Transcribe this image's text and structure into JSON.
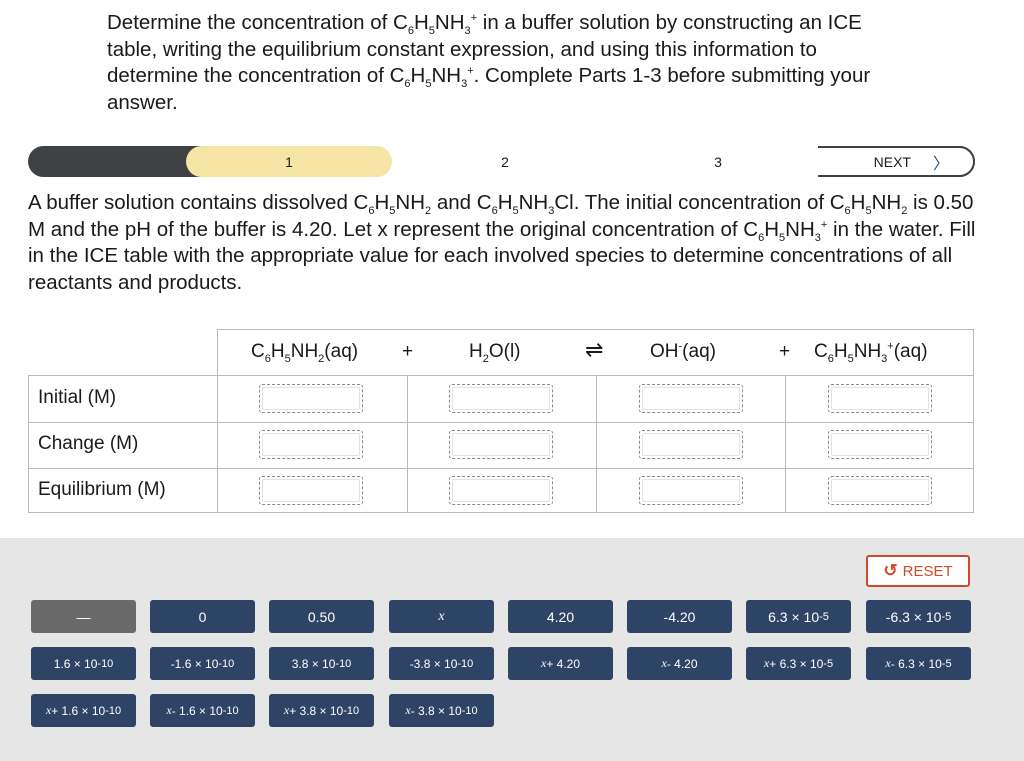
{
  "intro_html": "Determine the concentration of C<sub>6</sub>H<sub>5</sub>NH<sub>3</sub><sup>+</sup> in a buffer solution by constructing an ICE table, writing the equilibrium constant expression, and using this information to determine the concentration of C<sub>6</sub>H<sub>5</sub>NH<sub>3</sub><sup>+</sup>. Complete Parts 1-3 before submitting your answer.",
  "progress": {
    "steps": [
      "1",
      "2",
      "3"
    ],
    "active_step": "1",
    "next_label": "NEXT",
    "next_icon": "chevron-right-icon"
  },
  "question_html": "A buffer solution contains dissolved C<sub>6</sub>H<sub>5</sub>NH<sub>2</sub> and C<sub>6</sub>H<sub>5</sub>NH<sub>3</sub>Cl. The initial concentration of C<sub>6</sub>H<sub>5</sub>NH<sub>2</sub> is 0.50 M and the pH of the buffer is 4.20. Let x represent the original concentration of C<sub>6</sub>H<sub>5</sub>NH<sub>3</sub><sup>+</sup> in the water. Fill in the ICE table with the appropriate value for each involved species to determine concentrations of all reactants and products.",
  "ice_table": {
    "species_html": [
      "C<sub>6</sub>H<sub>5</sub>NH<sub>2</sub>(aq)",
      "+",
      "H<sub>2</sub>O(l)",
      "⇌",
      "OH<sup>-</sup>(aq)",
      "+",
      "C<sub>6</sub>H<sub>5</sub>NH<sub>3</sub><sup>+</sup>(aq)"
    ],
    "rows": [
      "Initial (M)",
      "Change (M)",
      "Equilibrium (M)"
    ]
  },
  "answer_tray": {
    "reset_label": "RESET",
    "reset_icon": "undo-icon",
    "tiles": [
      {
        "html": "—",
        "enabled": false
      },
      {
        "html": "0",
        "enabled": true
      },
      {
        "html": "0.50",
        "enabled": true
      },
      {
        "html": "<span class=\"ital\">x</span>",
        "enabled": true
      },
      {
        "html": "4.20",
        "enabled": true
      },
      {
        "html": "-4.20",
        "enabled": true
      },
      {
        "html": "6.3 × 10<sup>-5</sup>",
        "enabled": true
      },
      {
        "html": "-6.3 × 10<sup>-5</sup>",
        "enabled": true
      },
      {
        "html": "1.6 × 10<sup>-10</sup>",
        "enabled": true
      },
      {
        "html": "-1.6 × 10<sup>-10</sup>",
        "enabled": true
      },
      {
        "html": "3.8 × 10<sup>-10</sup>",
        "enabled": true
      },
      {
        "html": "-3.8 × 10<sup>-10</sup>",
        "enabled": true
      },
      {
        "html": "<span class=\"ital\">x</span> + 4.20",
        "enabled": true
      },
      {
        "html": "<span class=\"ital\">x</span> - 4.20",
        "enabled": true
      },
      {
        "html": "<span class=\"ital\">x</span> + 6.3 × 10<sup>-5</sup>",
        "enabled": true
      },
      {
        "html": "<span class=\"ital\">x</span> - 6.3 × 10<sup>-5</sup>",
        "enabled": true
      },
      {
        "html": "<span class=\"ital\">x</span> + 1.6 × 10<sup>-10</sup>",
        "enabled": true
      },
      {
        "html": "<span class=\"ital\">x</span> - 1.6 × 10<sup>-10</sup>",
        "enabled": true
      },
      {
        "html": "<span class=\"ital\">x</span> + 3.8 × 10<sup>-10</sup>",
        "enabled": true
      },
      {
        "html": "<span class=\"ital\">x</span> - 3.8 × 10<sup>-10</sup>",
        "enabled": true
      }
    ]
  }
}
